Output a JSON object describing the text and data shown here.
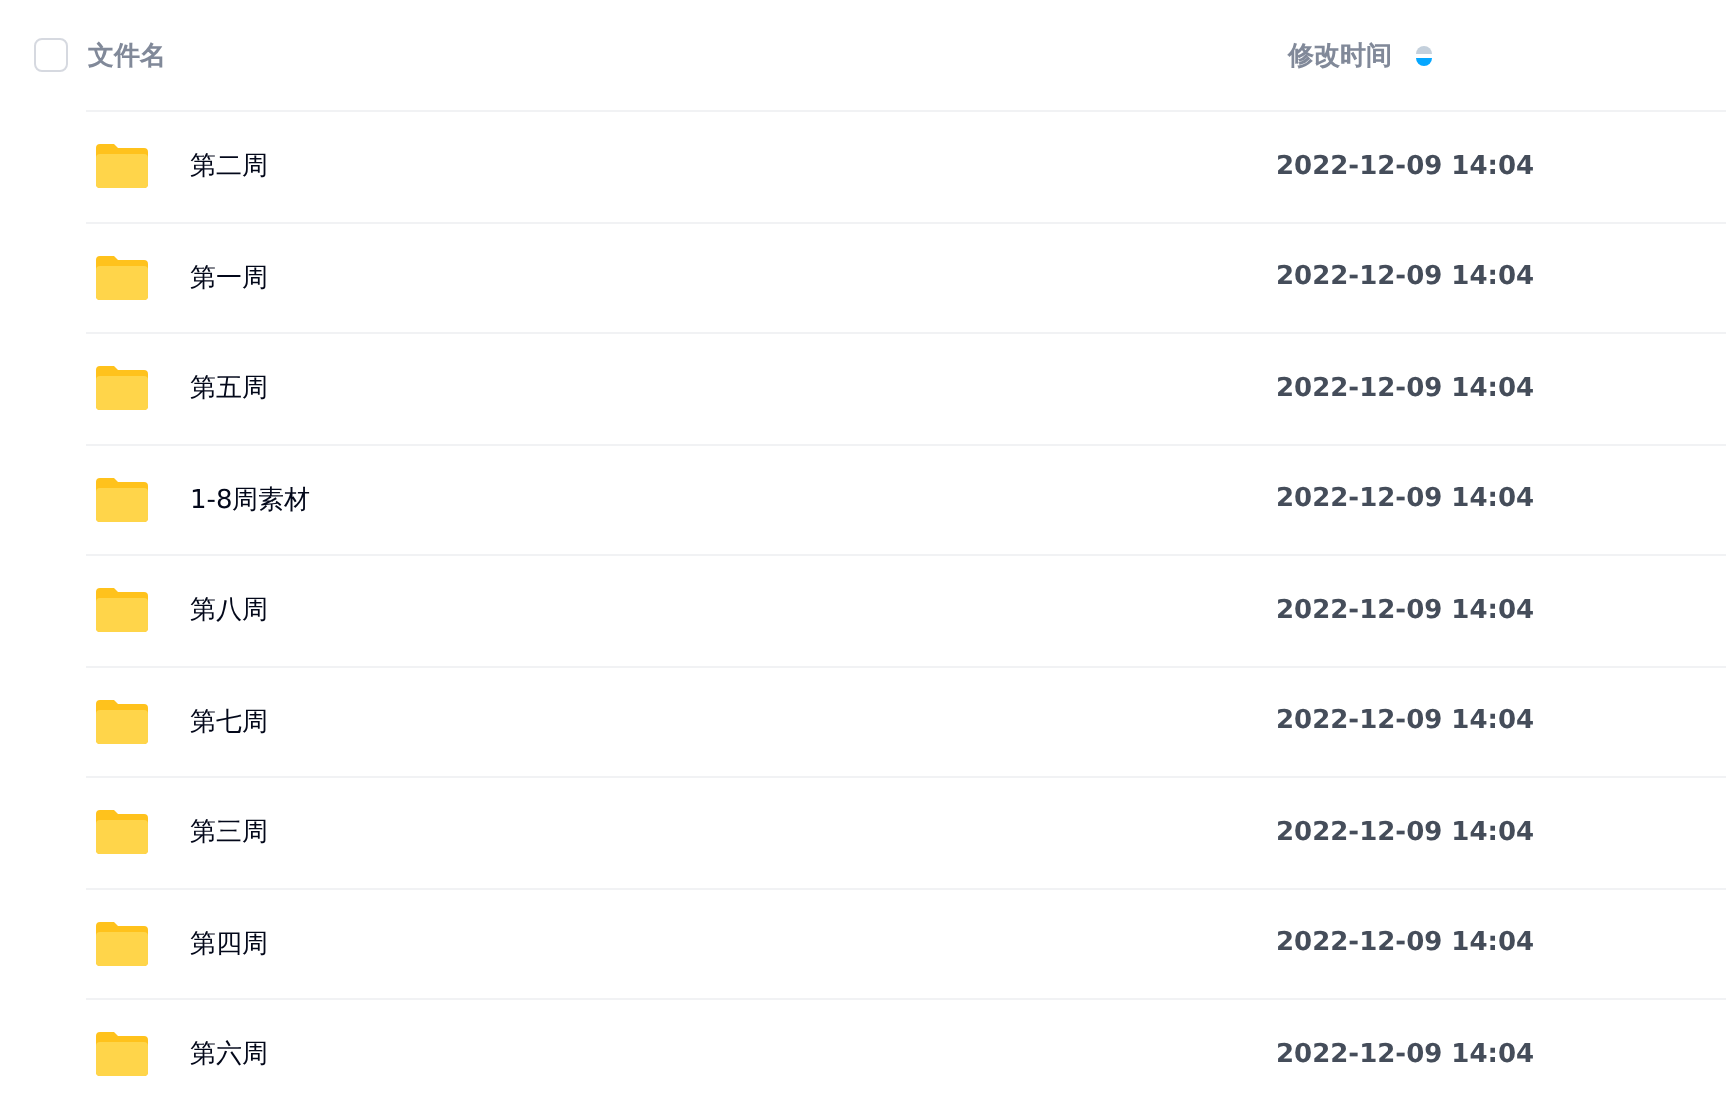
{
  "header": {
    "checked": false,
    "name_label": "文件名",
    "time_label": "修改时间",
    "sort_descending": true
  },
  "rows": [
    {
      "name": "第二周",
      "modified": "2022-12-09 14:04"
    },
    {
      "name": "第一周",
      "modified": "2022-12-09 14:04"
    },
    {
      "name": "第五周",
      "modified": "2022-12-09 14:04"
    },
    {
      "name": "1-8周素材",
      "modified": "2022-12-09 14:04"
    },
    {
      "name": "第八周",
      "modified": "2022-12-09 14:04"
    },
    {
      "name": "第七周",
      "modified": "2022-12-09 14:04"
    },
    {
      "name": "第三周",
      "modified": "2022-12-09 14:04"
    },
    {
      "name": "第四周",
      "modified": "2022-12-09 14:04"
    },
    {
      "name": "第六周",
      "modified": "2022-12-09 14:04"
    }
  ]
}
